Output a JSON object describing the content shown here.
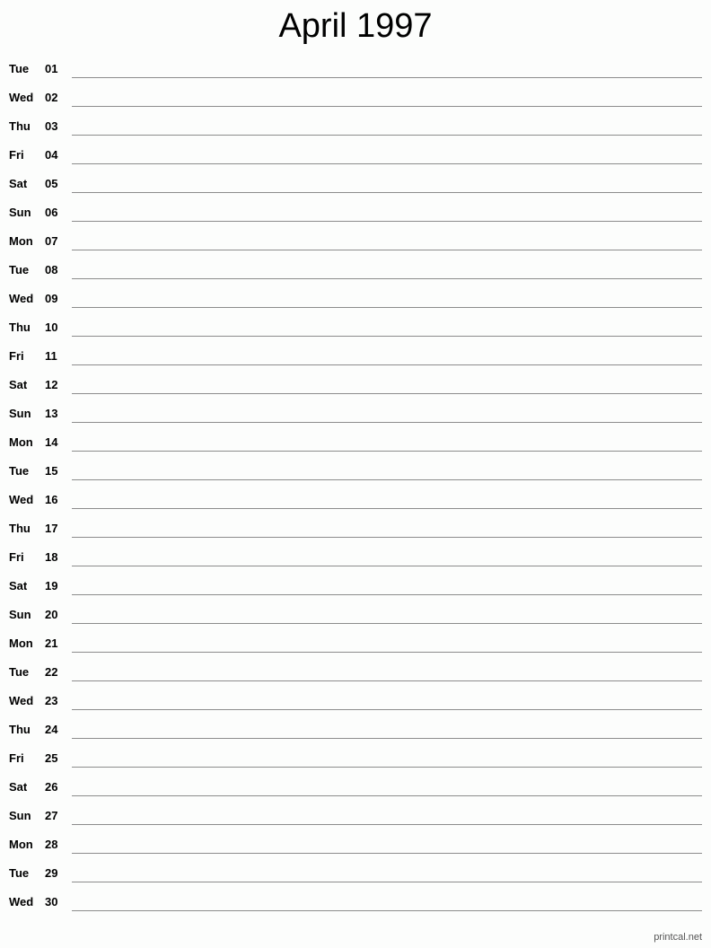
{
  "title": "April 1997",
  "days": [
    {
      "day": "Tue",
      "num": "01"
    },
    {
      "day": "Wed",
      "num": "02"
    },
    {
      "day": "Thu",
      "num": "03"
    },
    {
      "day": "Fri",
      "num": "04"
    },
    {
      "day": "Sat",
      "num": "05"
    },
    {
      "day": "Sun",
      "num": "06"
    },
    {
      "day": "Mon",
      "num": "07"
    },
    {
      "day": "Tue",
      "num": "08"
    },
    {
      "day": "Wed",
      "num": "09"
    },
    {
      "day": "Thu",
      "num": "10"
    },
    {
      "day": "Fri",
      "num": "11"
    },
    {
      "day": "Sat",
      "num": "12"
    },
    {
      "day": "Sun",
      "num": "13"
    },
    {
      "day": "Mon",
      "num": "14"
    },
    {
      "day": "Tue",
      "num": "15"
    },
    {
      "day": "Wed",
      "num": "16"
    },
    {
      "day": "Thu",
      "num": "17"
    },
    {
      "day": "Fri",
      "num": "18"
    },
    {
      "day": "Sat",
      "num": "19"
    },
    {
      "day": "Sun",
      "num": "20"
    },
    {
      "day": "Mon",
      "num": "21"
    },
    {
      "day": "Tue",
      "num": "22"
    },
    {
      "day": "Wed",
      "num": "23"
    },
    {
      "day": "Thu",
      "num": "24"
    },
    {
      "day": "Fri",
      "num": "25"
    },
    {
      "day": "Sat",
      "num": "26"
    },
    {
      "day": "Sun",
      "num": "27"
    },
    {
      "day": "Mon",
      "num": "28"
    },
    {
      "day": "Tue",
      "num": "29"
    },
    {
      "day": "Wed",
      "num": "30"
    }
  ],
  "footer": "printcal.net"
}
